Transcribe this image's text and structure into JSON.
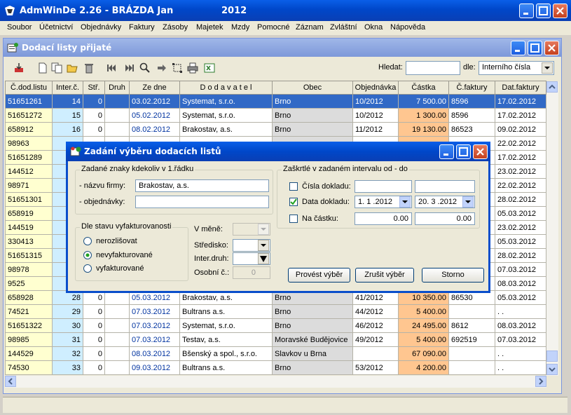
{
  "app": {
    "title": "AdmWinDe 2.26 - BRÁZDA Jan",
    "year": "2012"
  },
  "menu": [
    "Soubor",
    "Účetnictví",
    "Objednávky",
    "Faktury",
    "Zásoby",
    "Majetek",
    "Mzdy",
    "Pomocné",
    "Záznam",
    "Zvláštní",
    "Okna",
    "Nápověda"
  ],
  "child": {
    "title": "Dodací listy přijaté",
    "search_label": "Hledat:",
    "search_value": "",
    "by_label": "dle:",
    "by_value": "Interního čísla"
  },
  "columns": [
    "Č.dod.listu",
    "Inter.č.",
    "Stř.",
    "Druh",
    "Ze dne",
    "D o d a v a t e l",
    "Obec",
    "Objednávka",
    "Částka",
    "Č.faktury",
    "Dat.faktury"
  ],
  "rows": [
    [
      "51651261",
      "14",
      "0",
      "",
      "03.02.2012",
      "Systemat, s.r.o.",
      "Brno",
      "10/2012",
      "7 500.00",
      "8596",
      "17.02.2012"
    ],
    [
      "51651272",
      "15",
      "0",
      "",
      "05.02.2012",
      "Systemat, s.r.o.",
      "Brno",
      "10/2012",
      "1 300.00",
      "8596",
      "17.02.2012"
    ],
    [
      "658912",
      "16",
      "0",
      "",
      "08.02.2012",
      "Brakostav, a.s.",
      "Brno",
      "11/2012",
      "19 130.00",
      "86523",
      "09.02.2012"
    ],
    [
      "98963",
      "",
      "",
      "",
      "",
      "",
      "",
      "",
      "",
      "",
      "22.02.2012"
    ],
    [
      "51651289",
      "",
      "",
      "",
      "",
      "",
      "",
      "",
      "",
      "",
      "17.02.2012"
    ],
    [
      "144512",
      "",
      "",
      "",
      "",
      "",
      "",
      "",
      "",
      "",
      "23.02.2012"
    ],
    [
      "98971",
      "",
      "",
      "",
      "",
      "",
      "",
      "",
      "",
      "",
      "22.02.2012"
    ],
    [
      "51651301",
      "",
      "",
      "",
      "",
      "",
      "",
      "",
      "",
      "",
      "28.02.2012"
    ],
    [
      "658919",
      "",
      "",
      "",
      "",
      "",
      "",
      "",
      "",
      "",
      "05.03.2012"
    ],
    [
      "144519",
      "",
      "",
      "",
      "",
      "",
      "",
      "",
      "",
      "",
      "23.02.2012"
    ],
    [
      "330413",
      "",
      "",
      "",
      "",
      "",
      "",
      "",
      "",
      "",
      "05.03.2012"
    ],
    [
      "51651315",
      "",
      "",
      "",
      "",
      "",
      "",
      "",
      "",
      "",
      "28.02.2012"
    ],
    [
      "98978",
      "",
      "",
      "",
      "",
      "",
      "",
      "",
      "",
      "",
      "07.03.2012"
    ],
    [
      "9525",
      "",
      "",
      "",
      "",
      "",
      "",
      "",
      "",
      "",
      "08.03.2012"
    ],
    [
      "658928",
      "28",
      "0",
      "",
      "05.03.2012",
      "Brakostav, a.s.",
      "Brno",
      "41/2012",
      "10 350.00",
      "86530",
      "05.03.2012"
    ],
    [
      "74521",
      "29",
      "0",
      "",
      "07.03.2012",
      "Bultrans a.s.",
      "Brno",
      "44/2012",
      "5 400.00",
      "",
      ". ."
    ],
    [
      "51651322",
      "30",
      "0",
      "",
      "07.03.2012",
      "Systemat, s.r.o.",
      "Brno",
      "46/2012",
      "24 495.00",
      "8612",
      "08.03.2012"
    ],
    [
      "98985",
      "31",
      "0",
      "",
      "07.03.2012",
      "Testav, a.s.",
      "Moravské Budějovice",
      "49/2012",
      "5 400.00",
      "692519",
      "07.03.2012"
    ],
    [
      "144529",
      "32",
      "0",
      "",
      "08.03.2012",
      "Bšenský a spol., s.r.o.",
      "Slavkov u Brna",
      "",
      "67 090.00",
      "",
      ". ."
    ],
    [
      "74530",
      "33",
      "0",
      "",
      "09.03.2012",
      "Bultrans a.s.",
      "Brno",
      "53/2012",
      "4 200.00",
      "",
      ". ."
    ]
  ],
  "dialog": {
    "title": "Zadání výběru dodacích listů",
    "group1": "Zadané znaky kdekoliv v 1.řádku",
    "firm_label": "- názvu firmy:",
    "firm_value": "Brakostav, a.s.",
    "order_label": "- objednávky:",
    "order_value": "",
    "group2": "Zaškrtlé v zadaném intervalu od - do",
    "c1_label": "Čísla dokladu:",
    "c2_label": "Data dokladu:",
    "c3_label": "Na částku:",
    "date_from": "1. 1 .2012",
    "date_to": "20. 3 .2012",
    "amt_from": "0.00",
    "amt_to": "0.00",
    "group3": "Dle stavu vyfakturovanosti",
    "r1": "nerozlišovat",
    "r2": "nevyfakturované",
    "r3": "vyfakturované",
    "currency_label": "V měně:",
    "center_label": "Středisko:",
    "inter_label": "Inter.druh:",
    "person_label": "Osobní č.:",
    "person_value": "0",
    "btn_do": "Provést výběr",
    "btn_cancel_sel": "Zrušit výběr",
    "btn_storno": "Storno"
  },
  "colors": {
    "title_blue": "#0047c9",
    "selection": "#3169c6",
    "yellow": "#ffffd0",
    "cyan": "#cfeeff",
    "orange": "#ffc690"
  }
}
